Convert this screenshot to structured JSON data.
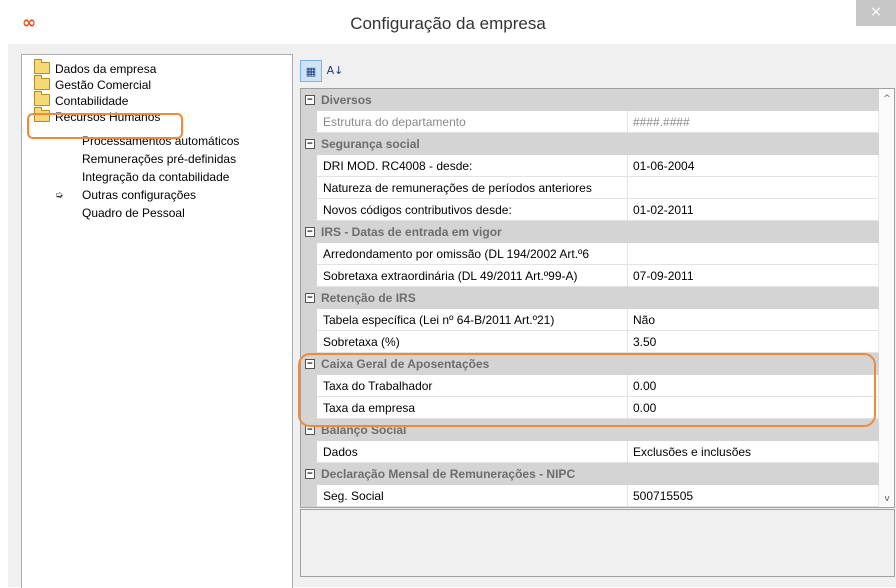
{
  "window": {
    "title": "Configuração da empresa",
    "app_icon": "∞",
    "close_symbol": "×"
  },
  "tree": {
    "items": [
      {
        "label": "Dados da empresa",
        "type": "folder"
      },
      {
        "label": "Gestão Comercial",
        "type": "folder"
      },
      {
        "label": "Contabilidade",
        "type": "folder"
      },
      {
        "label": "Recursos Humanos",
        "type": "folder",
        "selected": true
      },
      {
        "label": "Processamentos automáticos",
        "type": "child"
      },
      {
        "label": "Remunerações pré-definidas",
        "type": "child"
      },
      {
        "label": "Integração da contabilidade",
        "type": "child"
      },
      {
        "label": "Outras configurações",
        "type": "child",
        "current": true
      },
      {
        "label": "Quadro de Pessoal",
        "type": "child"
      }
    ],
    "current_marker": "➭"
  },
  "toolbar": {
    "categorized_icon": "categorized-icon",
    "alphabetical_icon": "sort-az-icon",
    "categorized_glyph": "▦",
    "alphabetical_glyph": "A↓"
  },
  "grid": {
    "toggle_symbol": "⊟",
    "scroll_up": "^",
    "scroll_down": "v",
    "categories": [
      {
        "name": "Diversos",
        "props": [
          {
            "name": "Estrutura do departamento",
            "value": "####.####",
            "disabled": true
          }
        ]
      },
      {
        "name": "Segurança social",
        "props": [
          {
            "name": "DRI MOD. RC4008 - desde:",
            "value": "01-06-2004"
          },
          {
            "name": "Natureza de remunerações de períodos anteriores",
            "value": ""
          },
          {
            "name": "Novos códigos contributivos desde:",
            "value": "01-02-2011"
          }
        ]
      },
      {
        "name": "IRS - Datas de entrada em vigor",
        "props": [
          {
            "name": "Arredondamento por omissão (DL 194/2002 Art.º6",
            "value": ""
          },
          {
            "name": "Sobretaxa extraordinária (DL 49/2011 Art.º99-A)",
            "value": "07-09-2011"
          }
        ]
      },
      {
        "name": "Retenção de IRS",
        "props": [
          {
            "name": "Tabela específica (Lei nº 64-B/2011 Art.º21)",
            "value": "Não"
          },
          {
            "name": "Sobretaxa (%)",
            "value": "3.50"
          }
        ]
      },
      {
        "name": "Caixa Geral de Aposentações",
        "props": [
          {
            "name": "Taxa do Trabalhador",
            "value": "0.00"
          },
          {
            "name": "Taxa da empresa",
            "value": "0.00"
          }
        ]
      },
      {
        "name": "Balanço Social",
        "props": [
          {
            "name": "Dados",
            "value": "Exclusões e inclusões"
          }
        ]
      },
      {
        "name": "Declaração Mensal de Remunerações - NIPC",
        "props": [
          {
            "name": "Seg. Social",
            "value": "500715505"
          }
        ]
      }
    ]
  },
  "colors": {
    "highlight": "#f08a3b",
    "category_bg": "#d4d4d4",
    "app_icon": "#e5531a"
  }
}
